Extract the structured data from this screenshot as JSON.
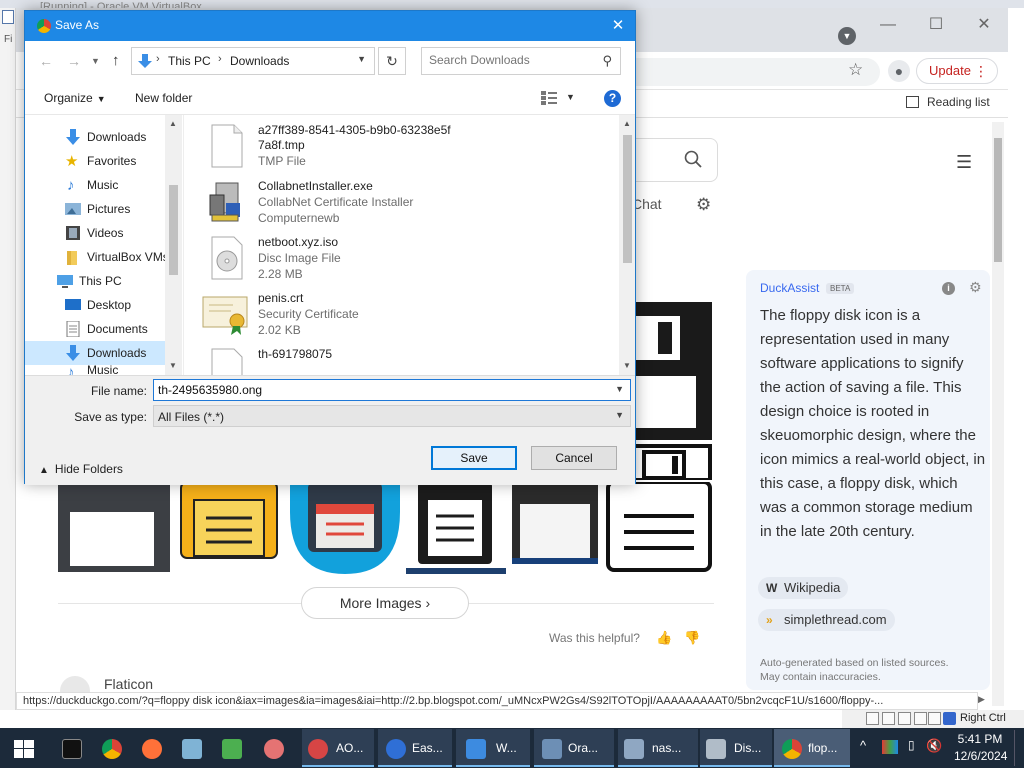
{
  "vm": {
    "title": "[Running] - Oracle VM VirtualBox",
    "left_label": "Fi",
    "status_right_ctrl": "Right Ctrl"
  },
  "browser": {
    "update_label": "Update",
    "reading_list_label": "Reading list",
    "status_url": "https://duckduckgo.com/?q=floppy disk icon&iax=images&ia=images&iai=http://2.bp.blogspot.com/_uMNcxPW2Gs4/S92lTOTOpjI/AAAAAAAAAT0/5bn2vcqcF1U/s1600/floppy-..."
  },
  "page": {
    "chat_label": "Chat",
    "more_images_label": "More Images",
    "helpful_label": "Was this helpful?",
    "flaticon_label": "Flaticon"
  },
  "duckassist": {
    "title": "DuckAssist",
    "badge": "BETA",
    "answer": "The floppy disk icon is a representation used in many software applications to signify the action of saving a file. This design choice is rooted in skeuomorphic design, where the icon mimics a real-world object, in this case, a floppy disk, which was a common storage medium in the late 20th century.",
    "sources": [
      {
        "icon": "W",
        "label": "Wikipedia"
      },
      {
        "icon": "»",
        "label": "simplethread.com"
      }
    ],
    "disclaimer_line1": "Auto-generated based on listed sources.",
    "disclaimer_line2": "May contain inaccuracies."
  },
  "dialog": {
    "title": "Save As",
    "breadcrumb": [
      "This PC",
      "Downloads"
    ],
    "search_placeholder": "Search Downloads",
    "organize_label": "Organize",
    "new_folder_label": "New folder",
    "nav_items": [
      {
        "label": "Downloads",
        "icon": "download-arrow-icon"
      },
      {
        "label": "Favorites",
        "icon": "star-icon"
      },
      {
        "label": "Music",
        "icon": "music-note-icon"
      },
      {
        "label": "Pictures",
        "icon": "pictures-icon"
      },
      {
        "label": "Videos",
        "icon": "videos-icon"
      },
      {
        "label": "VirtualBox VMs",
        "icon": "folder-icon"
      },
      {
        "label": "This PC",
        "icon": "computer-icon"
      },
      {
        "label": "Desktop",
        "icon": "desktop-icon"
      },
      {
        "label": "Documents",
        "icon": "documents-icon"
      },
      {
        "label": "Downloads",
        "icon": "download-arrow-icon",
        "selected": true
      },
      {
        "label": "Music",
        "icon": "music-note-icon"
      }
    ],
    "files": [
      {
        "name": "a27ff389-8541-4305-b9b0-63238e5f7a8f.tmp",
        "name_line1": "a27ff389-8541-4305-b9b0-63238e5f",
        "name_line2": "7a8f.tmp",
        "type": "TMP File",
        "size": ""
      },
      {
        "name": "CollabnetInstaller.exe",
        "type": "CollabNet Certificate Installer",
        "size": "Computernewb"
      },
      {
        "name": "netboot.xyz.iso",
        "type": "Disc Image File",
        "size": "2.28 MB"
      },
      {
        "name": "penis.crt",
        "type": "Security Certificate",
        "size": "2.02 KB"
      },
      {
        "name": "th-691798075",
        "type": "",
        "size": ""
      }
    ],
    "file_name_label": "File name:",
    "file_name_value": "th-2495635980.ong",
    "save_type_label": "Save as type:",
    "save_type_value": "All Files (*.*)",
    "hide_folders_label": "Hide Folders",
    "save_label": "Save",
    "cancel_label": "Cancel"
  },
  "taskbar": {
    "items": [
      {
        "label": "AO...",
        "icon": "chrome-red-icon"
      },
      {
        "label": "Eas...",
        "icon": "app-blue-icon"
      },
      {
        "label": "W...",
        "icon": "download-arrow-icon"
      },
      {
        "label": "Ora...",
        "icon": "virtualbox-icon"
      },
      {
        "label": "nas...",
        "icon": "vm-window-icon"
      },
      {
        "label": "Dis...",
        "icon": "disk-icon"
      },
      {
        "label": "flop...",
        "icon": "chrome-icon"
      }
    ],
    "time": "5:41 PM",
    "date": "12/6/2024"
  }
}
